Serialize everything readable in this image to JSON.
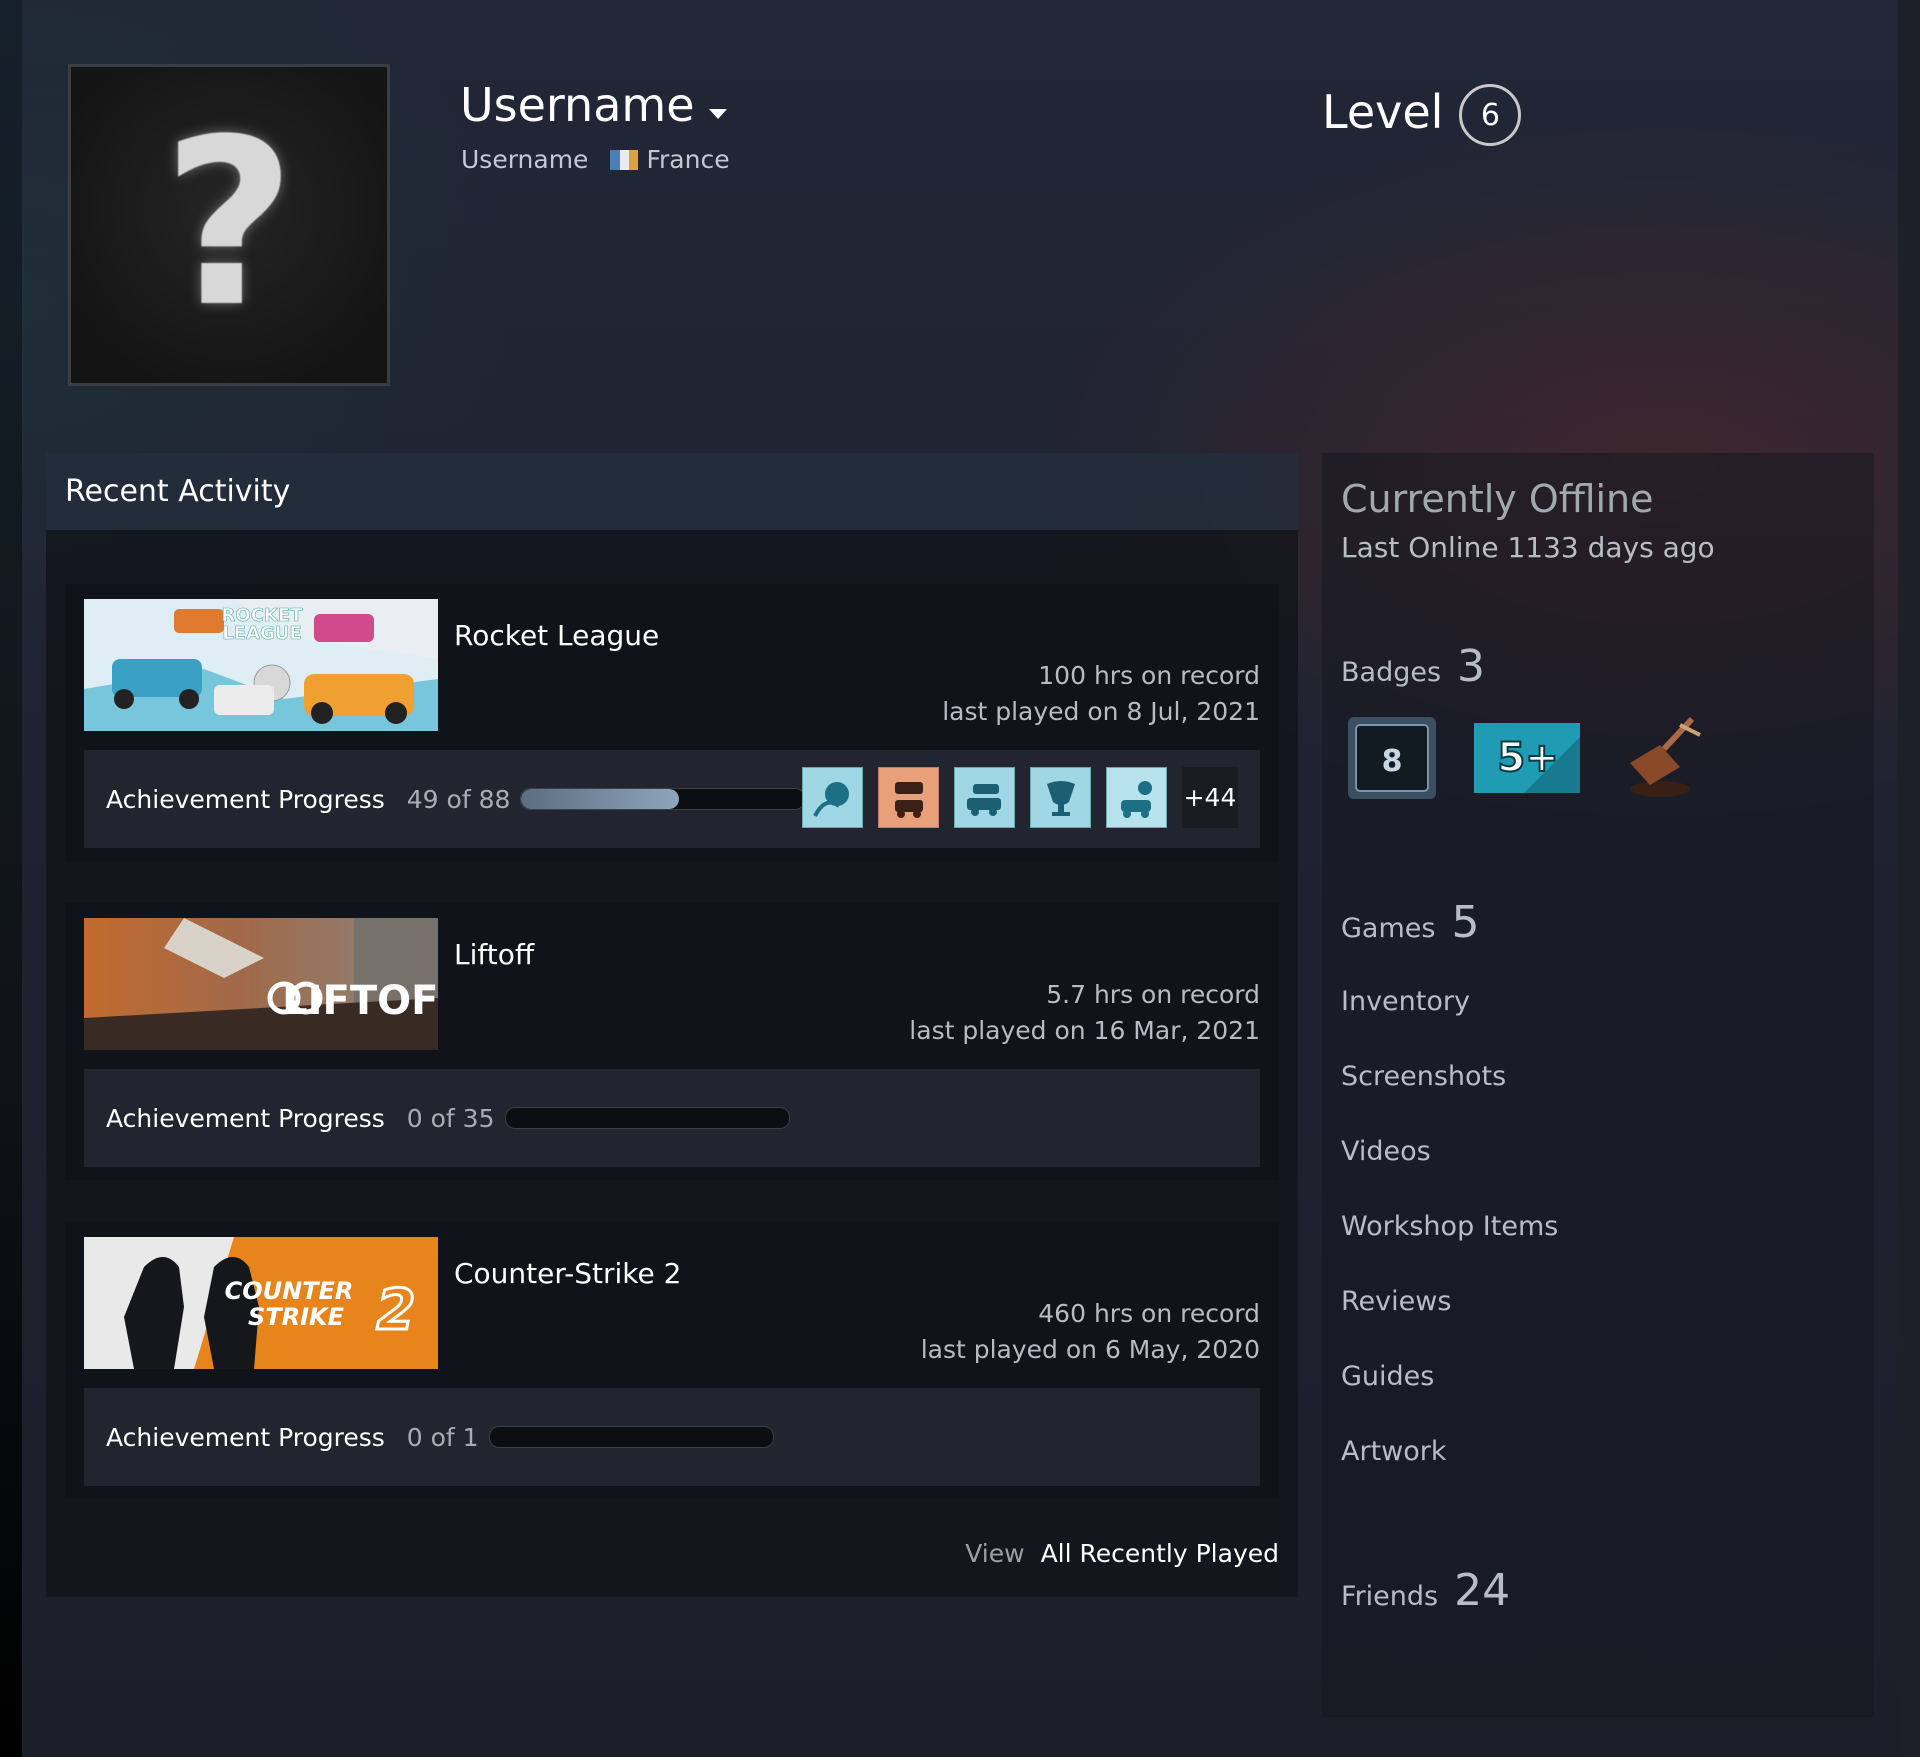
{
  "profile": {
    "persona_name": "Username",
    "real_name": "Username",
    "country": "France",
    "level_label": "Level",
    "level": "6",
    "avatar_icon": "question-mark-icon"
  },
  "recent": {
    "title": "Recent Activity",
    "achievement_label": "Achievement Progress",
    "view_prefix": "View",
    "view_link": "All Recently Played",
    "games": [
      {
        "name": "Rocket League",
        "hours": "100 hrs on record",
        "last_played": "last played on 8 Jul, 2021",
        "achievements": "49 of 88",
        "achievement_fraction": 0.557,
        "more_achievements": "+44"
      },
      {
        "name": "Liftoff",
        "hours": "5.7 hrs on record",
        "last_played": "last played on 16 Mar, 2021",
        "achievements": "0 of 35",
        "achievement_fraction": 0
      },
      {
        "name": "Counter-Strike 2",
        "hours": "460 hrs on record",
        "last_played": "last played on 6 May, 2020",
        "achievements": "0 of 1",
        "achievement_fraction": 0
      }
    ]
  },
  "sidebar": {
    "status": "Currently Offline",
    "last_online": "Last Online 1133 days ago",
    "badges_label": "Badges",
    "badges_count": "3",
    "badge1_text": "8",
    "badge2_text": "5+",
    "games_label": "Games",
    "games_count": "5",
    "links": [
      "Inventory",
      "Screenshots",
      "Videos",
      "Workshop Items",
      "Reviews",
      "Guides",
      "Artwork"
    ],
    "friends_label": "Friends",
    "friends_count": "24"
  },
  "colors": {
    "accent_blue": "#8ea5bb",
    "cs2_orange": "#e8841c",
    "badge_teal": "#1f9bb3"
  }
}
